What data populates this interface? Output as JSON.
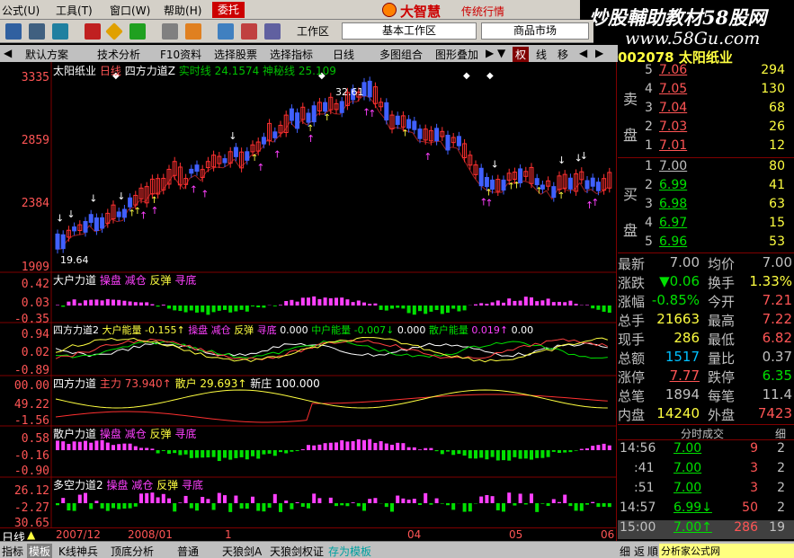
{
  "menubar": {
    "items": [
      {
        "label": "公式",
        "key": "(U)"
      },
      {
        "label": "工具",
        "key": "(T)"
      },
      {
        "label": "窗口",
        "key": "(W)"
      },
      {
        "label": "帮助",
        "key": "(H)"
      }
    ],
    "hot_button": "委托",
    "brand": "大智慧",
    "brand_sub": "传统行情",
    "watermark": "炒股輔助教材58股网",
    "watermark_url": "www.58Gu.com"
  },
  "toolbar": {
    "workarea_label": "工作区",
    "workarea_value": "基本工作区",
    "market_value": "商品市场"
  },
  "tabs": [
    "默认方案",
    "技术分析",
    "F10资料",
    "选择股票",
    "选择指标",
    "日线",
    "多图组合",
    "图形叠加"
  ],
  "tabs_right": [
    "权",
    "线",
    "移"
  ],
  "main_chart": {
    "stock_name": "太阳纸业",
    "period": "日线",
    "indicator": "四方力道Z",
    "indicator_extra": "实时线",
    "extra_values": "24.1574",
    "extra_label2": "神秘线",
    "extra_value2": "25.109",
    "y_ticks": [
      "3335",
      "2859",
      "2384",
      "1909"
    ],
    "high_label": "32.61",
    "low_label": "19.64"
  },
  "panes": [
    {
      "title": "大户力道",
      "labels": [
        "操盘",
        "减仓",
        "反弹",
        "寻底"
      ],
      "y_ticks": [
        "0.42",
        "0.03",
        "-0.35"
      ]
    },
    {
      "title": "四方力道2",
      "labels": [
        "大户能量",
        "-0.155↑",
        "操盘",
        "减仓",
        "反弹",
        "寻底",
        "0.000",
        "中户能量",
        "-0.007↓",
        "0.000",
        "散户能量",
        "0.019↑",
        "0.00"
      ],
      "y_ticks": [
        "0.94",
        "0.02",
        "-0.89"
      ]
    },
    {
      "title": "四方力道",
      "labels": [
        "主力",
        "73.940↑",
        "散户",
        "29.693↑",
        "新庄",
        "100.000"
      ],
      "y_ticks": [
        "00.00",
        "49.22",
        "-1.56"
      ]
    },
    {
      "title": "散户力道",
      "labels": [
        "操盘",
        "减仓",
        "反弹",
        "寻底"
      ],
      "y_ticks": [
        "0.58",
        "-0.16",
        "-0.90"
      ]
    },
    {
      "title": "多空力道2",
      "labels": [
        "操盘",
        "减仓",
        "反弹",
        "寻底"
      ],
      "y_ticks": [
        "26.12",
        "-2.27",
        "30.65"
      ]
    }
  ],
  "x_axis": {
    "period": "日线",
    "dates": [
      "2007/12",
      "2008/01",
      "1",
      "04",
      "05",
      "06"
    ]
  },
  "right_panel": {
    "stock_code": "002078",
    "stock_name": "太阳纸业",
    "sell_label": "卖盘",
    "buy_label": "买盘",
    "asks": [
      {
        "level": "5",
        "price": "7.06",
        "vol": "294"
      },
      {
        "level": "4",
        "price": "7.05",
        "vol": "130"
      },
      {
        "level": "3",
        "price": "7.04",
        "vol": "68"
      },
      {
        "level": "2",
        "price": "7.03",
        "vol": "26"
      },
      {
        "level": "1",
        "price": "7.01",
        "vol": "12"
      }
    ],
    "bids": [
      {
        "level": "1",
        "price": "7.00",
        "vol": "80"
      },
      {
        "level": "2",
        "price": "6.99",
        "vol": "41"
      },
      {
        "level": "3",
        "price": "6.98",
        "vol": "63"
      },
      {
        "level": "4",
        "price": "6.97",
        "vol": "15"
      },
      {
        "level": "5",
        "price": "6.96",
        "vol": "53"
      }
    ],
    "stats": [
      {
        "k1": "最新",
        "v1": "7.00",
        "k2": "均价",
        "v2": "7.00"
      },
      {
        "k1": "涨跌",
        "v1": "▼0.06",
        "k2": "换手",
        "v2": "1.33%"
      },
      {
        "k1": "涨幅",
        "v1": "-0.85%",
        "k2": "今开",
        "v2": "7.21"
      },
      {
        "k1": "总手",
        "v1": "21663",
        "k2": "最高",
        "v2": "7.22"
      },
      {
        "k1": "现手",
        "v1": "286",
        "k2": "最低",
        "v2": "6.82"
      },
      {
        "k1": "总额",
        "v1": "1517",
        "k2": "量比",
        "v2": "0.37"
      },
      {
        "k1": "涨停",
        "v1": "7.77",
        "k2": "跌停",
        "v2": "6.35"
      },
      {
        "k1": "总笔",
        "v1": "1894",
        "k2": "每笔",
        "v2": "11.4"
      },
      {
        "k1": "内盘",
        "v1": "14240",
        "k2": "外盘",
        "v2": "7423"
      }
    ],
    "ticks_title": "分时成交",
    "ticks_btn": "细",
    "ticks": [
      {
        "time": "14:56",
        "price": "7.00",
        "vol": "9",
        "n": "2"
      },
      {
        "time": ":41",
        "price": "7.00",
        "vol": "3",
        "n": "2"
      },
      {
        "time": ":51",
        "price": "7.00",
        "vol": "3",
        "n": "2"
      },
      {
        "time": "14:57",
        "price": "6.99↓",
        "vol": "50",
        "n": "2"
      },
      {
        "time": "15:00",
        "price": "7.00↑",
        "vol": "286",
        "n": "19"
      }
    ]
  },
  "bottom_bar": {
    "tabs": [
      "指标",
      "模板",
      "K线神兵",
      "顶底分析",
      "普通",
      "天狼剑A",
      "天狼剑权证",
      "存为模板"
    ],
    "right_tabs": [
      "细",
      "返",
      "順"
    ],
    "credit": "分析家公式网www.88gg.com"
  },
  "colors": {
    "up": "#ff3030",
    "down": "#4060ff",
    "magenta": "#ff40ff",
    "green": "#00e000",
    "yellow": "#ffff40",
    "axis_red": "#ff5555",
    "border": "#800000"
  }
}
